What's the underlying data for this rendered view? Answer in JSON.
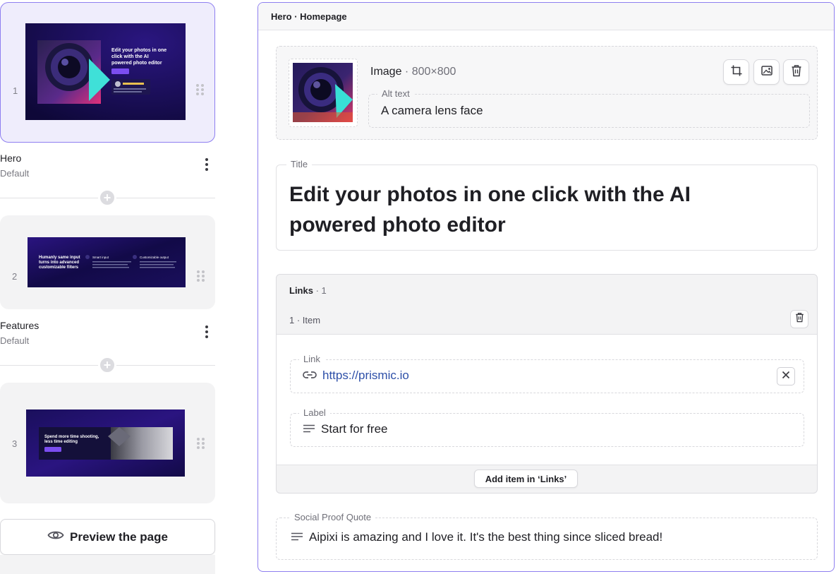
{
  "sidebar": {
    "slices": [
      {
        "number": "1",
        "name": "Hero",
        "variant": "Default",
        "thumb": {
          "headline": "Edit your photos in one click with the AI powered photo editor"
        }
      },
      {
        "number": "2",
        "name": "Features",
        "variant": "Default",
        "thumb": {
          "headline": "Humanly same input turns into advanced customizable filters",
          "col1": "Smart input",
          "col2": "Customizable output"
        }
      },
      {
        "number": "3",
        "thumb": {
          "headline": "Spend more time shooting, less time editing"
        }
      }
    ],
    "add_icon": "plus-icon",
    "preview_button": {
      "icon": "eye-icon",
      "label": "Preview the page"
    }
  },
  "editor": {
    "header": "Hero · Homepage",
    "image": {
      "label": "Image",
      "dimensions": "· 800×800",
      "alt_label": "Alt text",
      "alt_value": "A camera lens face",
      "tools": [
        "crop-icon",
        "replace-image-icon",
        "trash-icon"
      ]
    },
    "title": {
      "label": "Title",
      "value": "Edit your photos in one click with the AI powered photo editor"
    },
    "links": {
      "label": "Links",
      "count": "· 1",
      "item_header": "1 · Item",
      "link_label": "Link",
      "link_value": "https://prismic.io",
      "label_label": "Label",
      "label_value": "Start for free",
      "add_button": "Add item in ‘Links’"
    },
    "quote": {
      "label": "Social Proof Quote",
      "value": "Aipixi is amazing and I love it. It's the best thing since sliced bread!"
    }
  },
  "colors": {
    "accent": "#8e7ff0",
    "active_bg": "#efedfc",
    "link": "#2d4fa8",
    "thumb_bg": "#1a0f5c"
  }
}
